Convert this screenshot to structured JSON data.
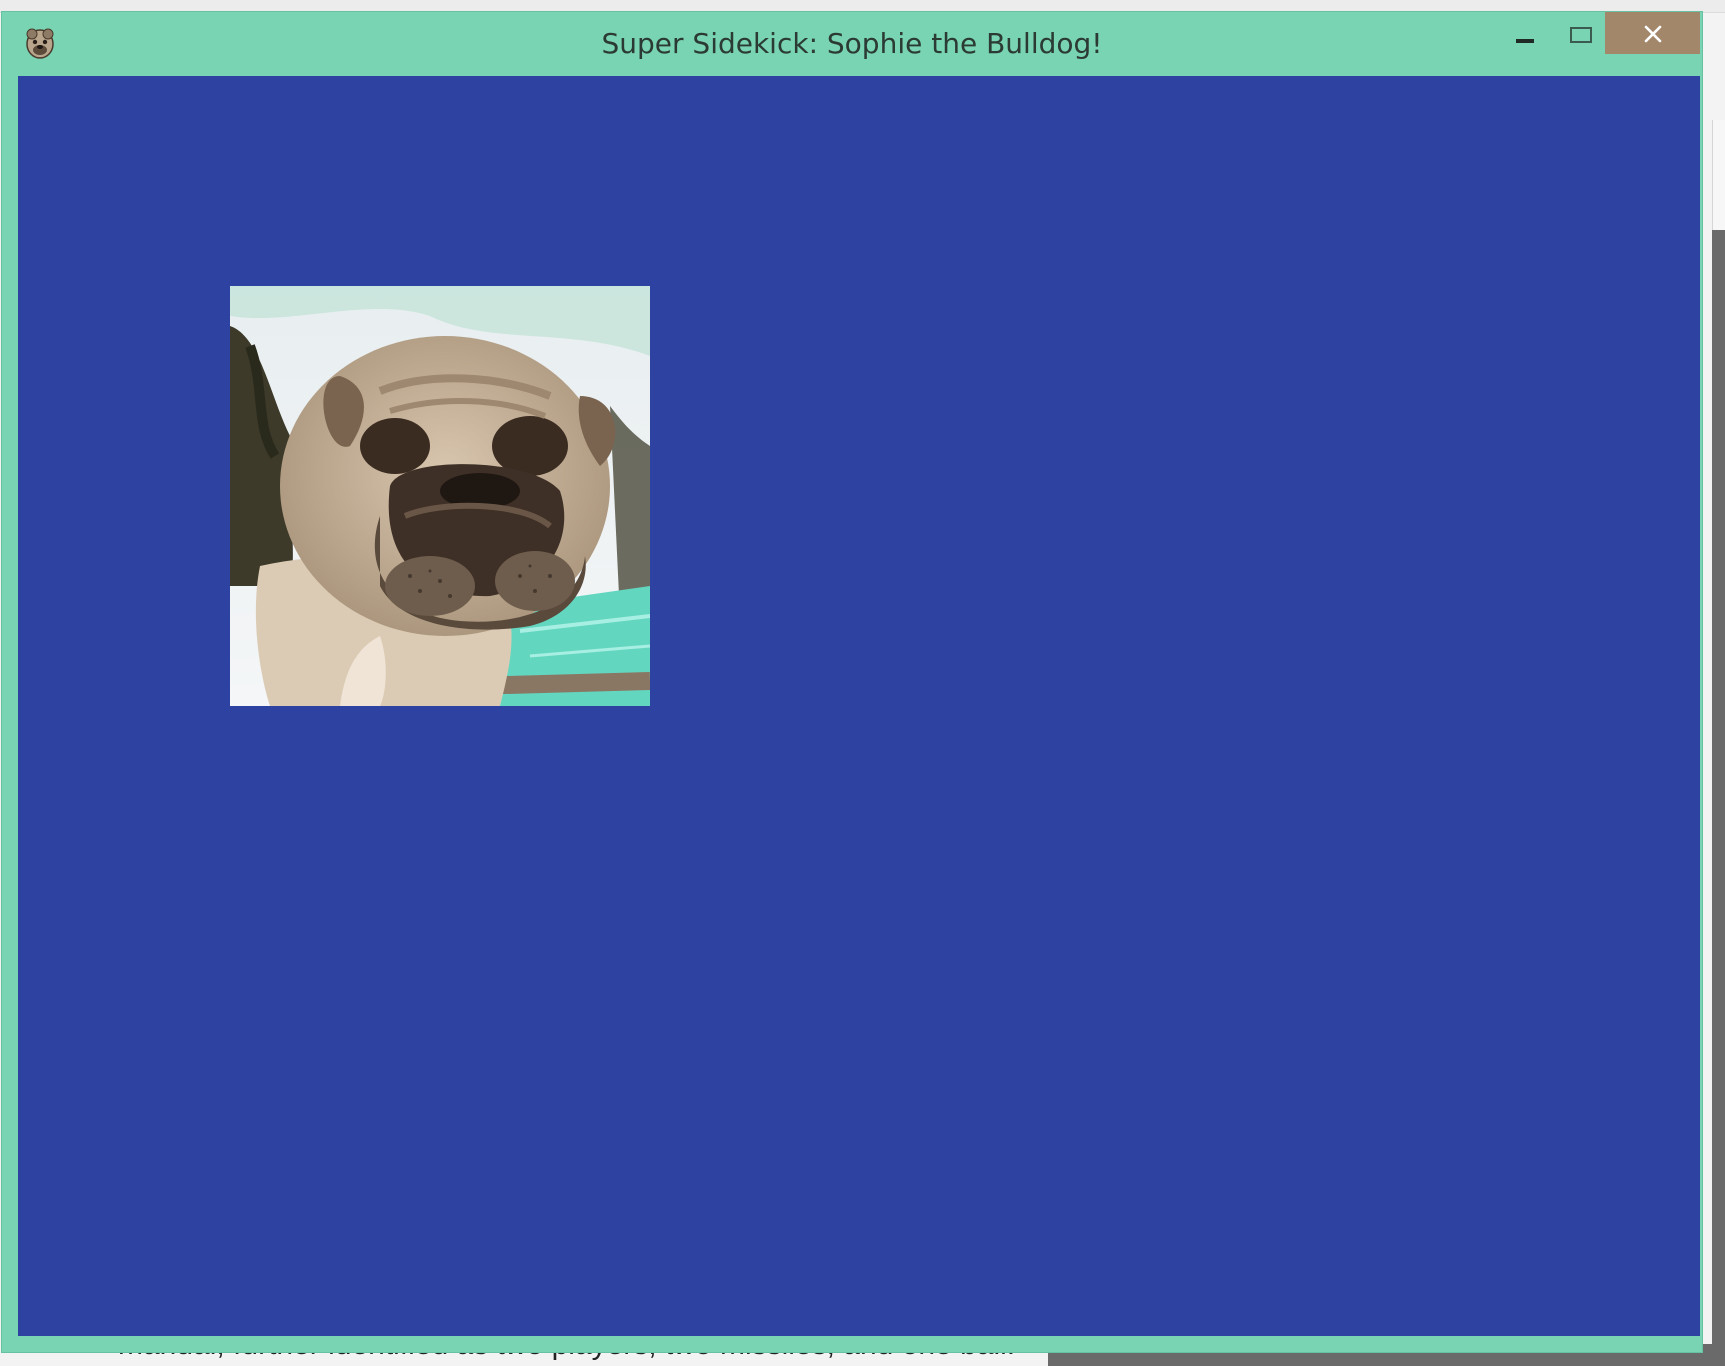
{
  "window": {
    "title": "Super Sidekick: Sophie the Bulldog!",
    "icon": "bulldog-app-icon",
    "controls": {
      "minimize": "minimize-icon",
      "maximize": "maximize-icon",
      "close": "close-icon"
    },
    "colors": {
      "frame": "#78d4b2",
      "close_button": "#a3876a",
      "canvas_background": "#2e43a1"
    }
  },
  "canvas": {
    "sprite": "bulldog-photo-sprite"
  },
  "background_document": {
    "partial_text": "manual, further identified as two players, two missiles, and one ball:"
  }
}
